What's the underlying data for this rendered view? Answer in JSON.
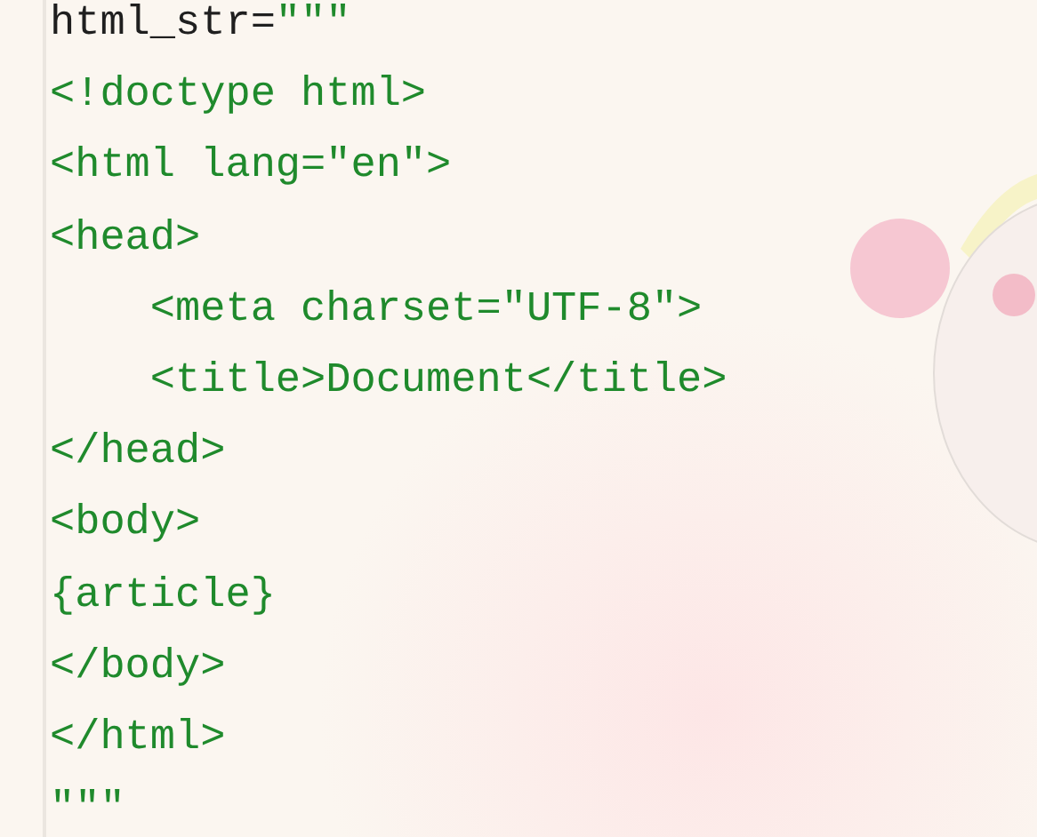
{
  "editor": {
    "lines": [
      {
        "segments": [
          {
            "text": "html_str=",
            "kind": "code"
          },
          {
            "text": "\"\"\"",
            "kind": "string"
          }
        ]
      },
      {
        "segments": [
          {
            "text": "<!doctype html>",
            "kind": "string"
          }
        ]
      },
      {
        "segments": [
          {
            "text": "<html lang=\"en\">",
            "kind": "string"
          }
        ]
      },
      {
        "segments": [
          {
            "text": "<head>",
            "kind": "string"
          }
        ]
      },
      {
        "segments": [
          {
            "text": "    <meta charset=\"UTF-8\">",
            "kind": "string"
          }
        ]
      },
      {
        "segments": [
          {
            "text": "    <title>Document</title>",
            "kind": "string"
          }
        ]
      },
      {
        "segments": [
          {
            "text": "</head>",
            "kind": "string"
          }
        ]
      },
      {
        "segments": [
          {
            "text": "<body>",
            "kind": "string"
          }
        ]
      },
      {
        "segments": [
          {
            "text": "{article}",
            "kind": "string"
          }
        ]
      },
      {
        "segments": [
          {
            "text": "</body>",
            "kind": "string"
          }
        ]
      },
      {
        "segments": [
          {
            "text": "</html>",
            "kind": "string"
          }
        ]
      },
      {
        "segments": [
          {
            "text": "\"\"\"",
            "kind": "string"
          }
        ]
      }
    ]
  }
}
